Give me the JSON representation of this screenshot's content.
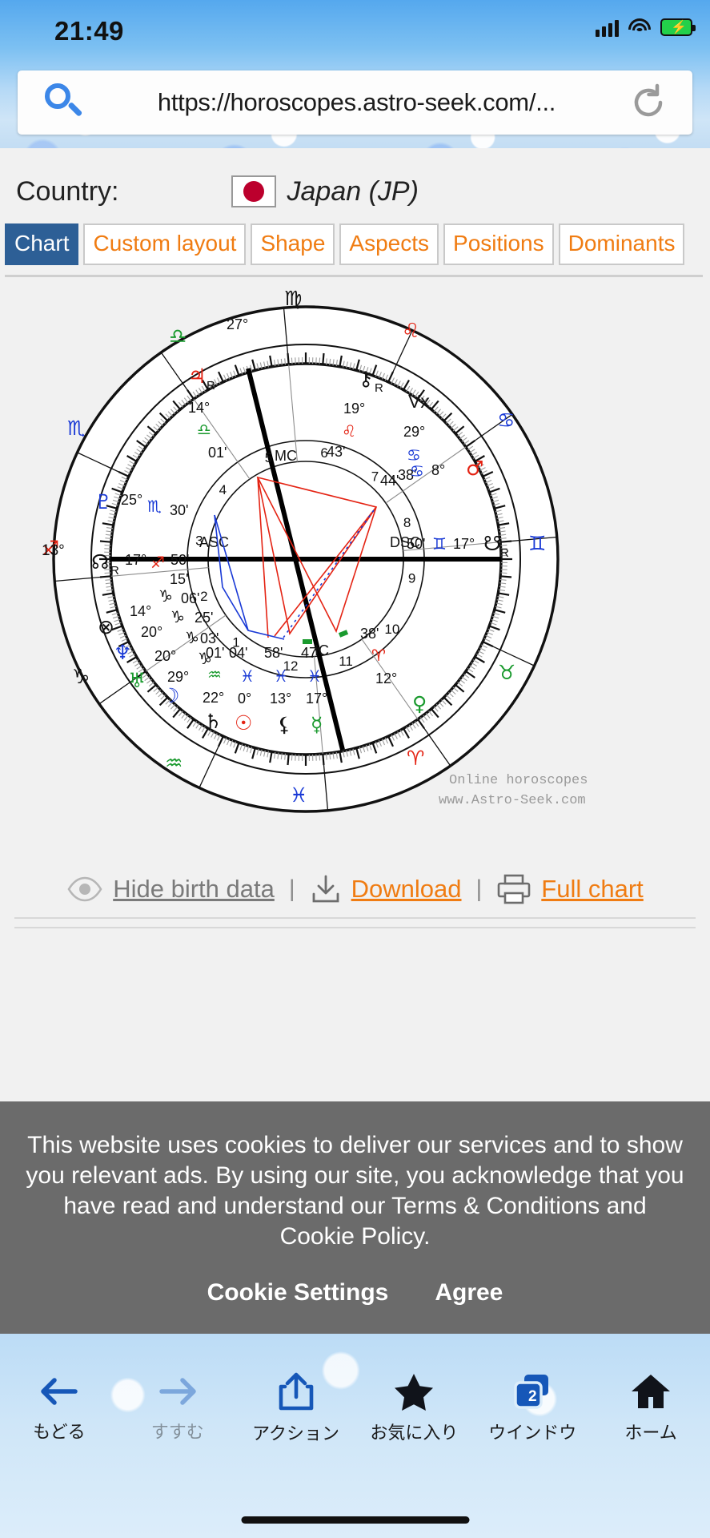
{
  "status_bar": {
    "time": "21:49",
    "signal": "cellular-signal-icon",
    "wifi": "wifi-icon",
    "battery": "battery-charging-icon"
  },
  "browser": {
    "url": "https://horoscopes.astro-seek.com/...",
    "search_icon": "search-icon",
    "reload_icon": "reload-icon"
  },
  "form": {
    "country_label": "Country:",
    "country_value": "Japan (JP)",
    "flag_icon": "japan-flag-icon"
  },
  "tabs": [
    {
      "label": "Chart",
      "active": true
    },
    {
      "label": "Custom layout",
      "active": false
    },
    {
      "label": "Shape",
      "active": false
    },
    {
      "label": "Aspects",
      "active": false
    },
    {
      "label": "Positions",
      "active": false
    },
    {
      "label": "Dominants",
      "active": false
    }
  ],
  "chart": {
    "credit_line1": "Online horoscopes",
    "credit_line2": "www.Astro-Seek.com",
    "angles": [
      {
        "name": "MC",
        "label": "MC",
        "degree": "27°"
      },
      {
        "name": "ASC",
        "label": "ASC",
        "degree": "13°"
      },
      {
        "name": "DSC",
        "label": "DSC",
        "degree": ""
      },
      {
        "name": "IC",
        "label": "IC",
        "degree": ""
      }
    ],
    "house_numbers": [
      "1",
      "2",
      "3",
      "4",
      "5",
      "6",
      "7",
      "8",
      "9",
      "10",
      "11",
      "12"
    ],
    "zodiac_outer": [
      "♍",
      "♌",
      "♋",
      "♊",
      "♉",
      "♈",
      "♓",
      "♒",
      "♑",
      "♐",
      "♏",
      "♎"
    ],
    "placements": [
      {
        "body": "Jupiter",
        "glyph": "♃",
        "retro": "R",
        "deg": "14°",
        "sign": "♎",
        "min": "01'"
      },
      {
        "body": "Chiron",
        "glyph": "⚷",
        "retro": "R",
        "deg": "19°",
        "sign": "♌",
        "min": "43'"
      },
      {
        "body": "Vertex",
        "glyph": "Vx",
        "retro": "",
        "deg": "29°",
        "sign": "♋",
        "min": "38'"
      },
      {
        "body": "Mars",
        "glyph": "♂",
        "retro": "",
        "deg": "8°",
        "sign": "♋",
        "min": "44'"
      },
      {
        "body": "South Node",
        "glyph": "☋",
        "retro": "R",
        "deg": "17°",
        "sign": "♊",
        "min": "50'"
      },
      {
        "body": "Venus",
        "glyph": "♀",
        "retro": "",
        "deg": "12°",
        "sign": "♈",
        "min": "38'"
      },
      {
        "body": "Mercury",
        "glyph": "☿",
        "retro": "",
        "deg": "17°",
        "sign": "♓",
        "min": "47'"
      },
      {
        "body": "Lilith",
        "glyph": "⚸",
        "retro": "",
        "deg": "13°",
        "sign": "♓",
        "min": "58'"
      },
      {
        "body": "Sun",
        "glyph": "☉",
        "retro": "",
        "deg": "0°",
        "sign": "♓",
        "min": "04'"
      },
      {
        "body": "Saturn",
        "glyph": "♄",
        "retro": "",
        "deg": "22°",
        "sign": "♒",
        "min": "01'"
      },
      {
        "body": "Moon",
        "glyph": "☽",
        "retro": "",
        "deg": "29°",
        "sign": "♑",
        "min": "03'"
      },
      {
        "body": "Uranus",
        "glyph": "♅",
        "retro": "",
        "deg": "20°",
        "sign": "♑",
        "min": "25'"
      },
      {
        "body": "Neptune",
        "glyph": "♆",
        "retro": "",
        "deg": "20°",
        "sign": "♑",
        "min": "06'"
      },
      {
        "body": "Part of Fortune",
        "glyph": "⊗",
        "retro": "",
        "deg": "14°",
        "sign": "♑",
        "min": "15'"
      },
      {
        "body": "North Node",
        "glyph": "☊",
        "retro": "R",
        "deg": "17°",
        "sign": "♐",
        "min": "50'"
      },
      {
        "body": "Pluto",
        "glyph": "♇",
        "retro": "",
        "deg": "25°",
        "sign": "♏",
        "min": "30'"
      }
    ]
  },
  "actions": {
    "hide_birth_data": "Hide birth data",
    "hide_icon": "eye-icon",
    "download": "Download",
    "download_icon": "download-icon",
    "full_chart": "Full chart",
    "print_icon": "printer-icon",
    "separator": "|"
  },
  "cookie": {
    "text": "This website uses cookies to deliver our services and to show you relevant ads. By using our site, you acknowledge that you have read and understand our Terms & Conditions and Cookie Policy.",
    "settings": "Cookie Settings",
    "settings_suffix": ".",
    "agree": "Agree"
  },
  "toolbar": [
    {
      "label": "もどる",
      "icon": "back-arrow-icon",
      "disabled": false
    },
    {
      "label": "すすむ",
      "icon": "forward-arrow-icon",
      "disabled": true
    },
    {
      "label": "アクション",
      "icon": "share-icon",
      "disabled": false
    },
    {
      "label": "お気に入り",
      "icon": "star-icon",
      "disabled": false
    },
    {
      "label": "ウインドウ",
      "icon": "tabs-icon",
      "disabled": false,
      "badge": "2"
    },
    {
      "label": "ホーム",
      "icon": "home-icon",
      "disabled": false
    }
  ],
  "colors": {
    "accent_orange": "#f07c12",
    "tab_active_blue": "#2d5f96",
    "cookie_bar": "#6b6b6b",
    "red": "#e42313",
    "blue": "#1a3ad6",
    "green": "#1a9a2e"
  }
}
